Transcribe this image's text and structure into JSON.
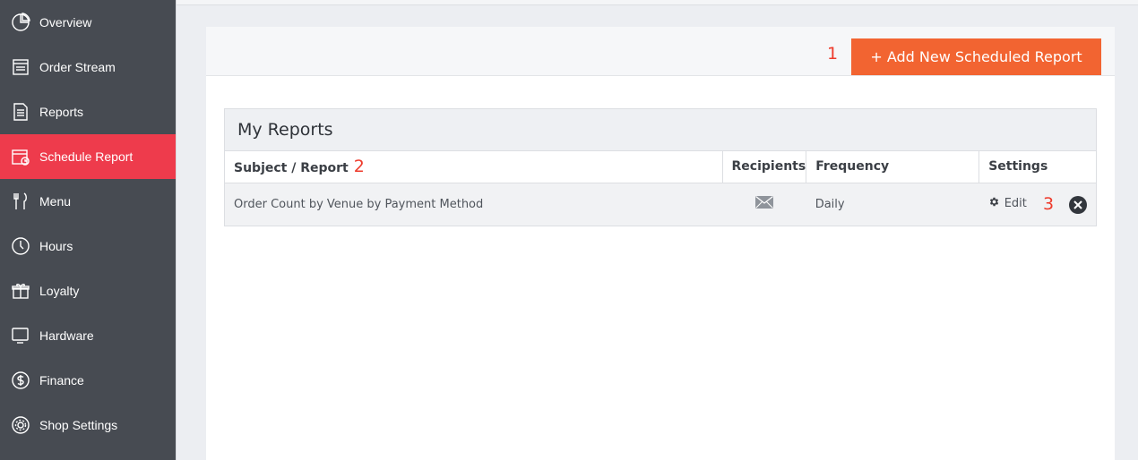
{
  "sidebar": {
    "items": [
      {
        "label": "Overview",
        "icon": "pie-chart-icon"
      },
      {
        "label": "Order Stream",
        "icon": "receipt-icon"
      },
      {
        "label": "Reports",
        "icon": "document-icon"
      },
      {
        "label": "Schedule Report",
        "icon": "calendar-clock-icon",
        "active": true
      },
      {
        "label": "Menu",
        "icon": "fork-knife-icon"
      },
      {
        "label": "Hours",
        "icon": "clock-icon"
      },
      {
        "label": "Loyalty",
        "icon": "gift-icon"
      },
      {
        "label": "Hardware",
        "icon": "monitor-icon"
      },
      {
        "label": "Finance",
        "icon": "dollar-circle-icon"
      },
      {
        "label": "Shop Settings",
        "icon": "gear-circle-icon"
      }
    ]
  },
  "header": {
    "annotation": "1",
    "add_button_label": "+ Add New Scheduled Report"
  },
  "reports": {
    "title": "My Reports",
    "columns": {
      "subject": "Subject / Report",
      "subject_annotation": "2",
      "recipients": "Recipients",
      "frequency": "Frequency",
      "settings": "Settings"
    },
    "rows": [
      {
        "subject": "Order Count by Venue by Payment Method",
        "frequency": "Daily",
        "edit_label": "Edit",
        "annotation": "3"
      }
    ]
  },
  "colors": {
    "sidebar_bg": "#474b52",
    "active_item": "#ee3b4c",
    "add_button": "#f26431",
    "annotation": "#ee3b2c"
  }
}
